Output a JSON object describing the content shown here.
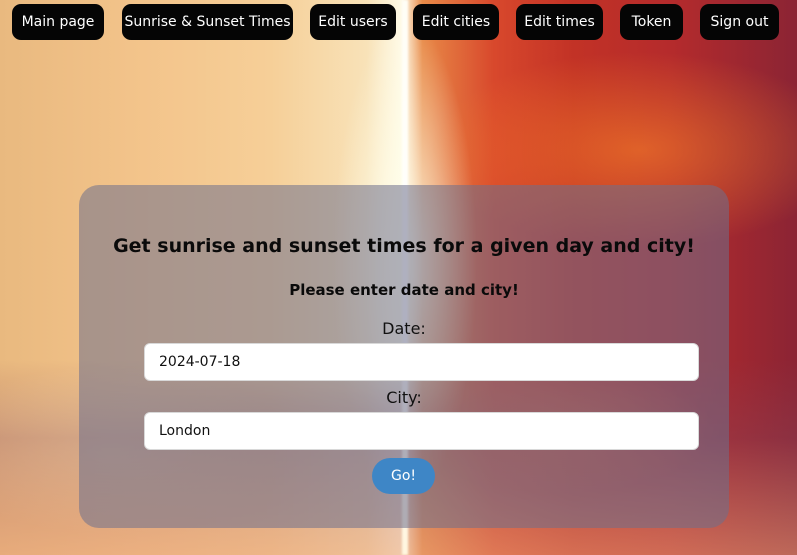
{
  "nav": {
    "items": [
      {
        "label": "Main page"
      },
      {
        "label": "Sunrise & Sunset Times"
      },
      {
        "label": "Edit users"
      },
      {
        "label": "Edit cities"
      },
      {
        "label": "Edit times"
      },
      {
        "label": "Token"
      },
      {
        "label": "Sign out"
      }
    ]
  },
  "form": {
    "title": "Get sunrise and sunset times for a given day and city!",
    "subtitle": "Please enter date and city!",
    "date_label": "Date:",
    "date_value": "2024-07-18",
    "city_label": "City:",
    "city_value": "London",
    "submit_label": "Go!"
  },
  "colors": {
    "nav_button": "#050505",
    "nav_text": "#ffffff",
    "submit_button": "#3e86c6",
    "panel": "#6e708c"
  }
}
